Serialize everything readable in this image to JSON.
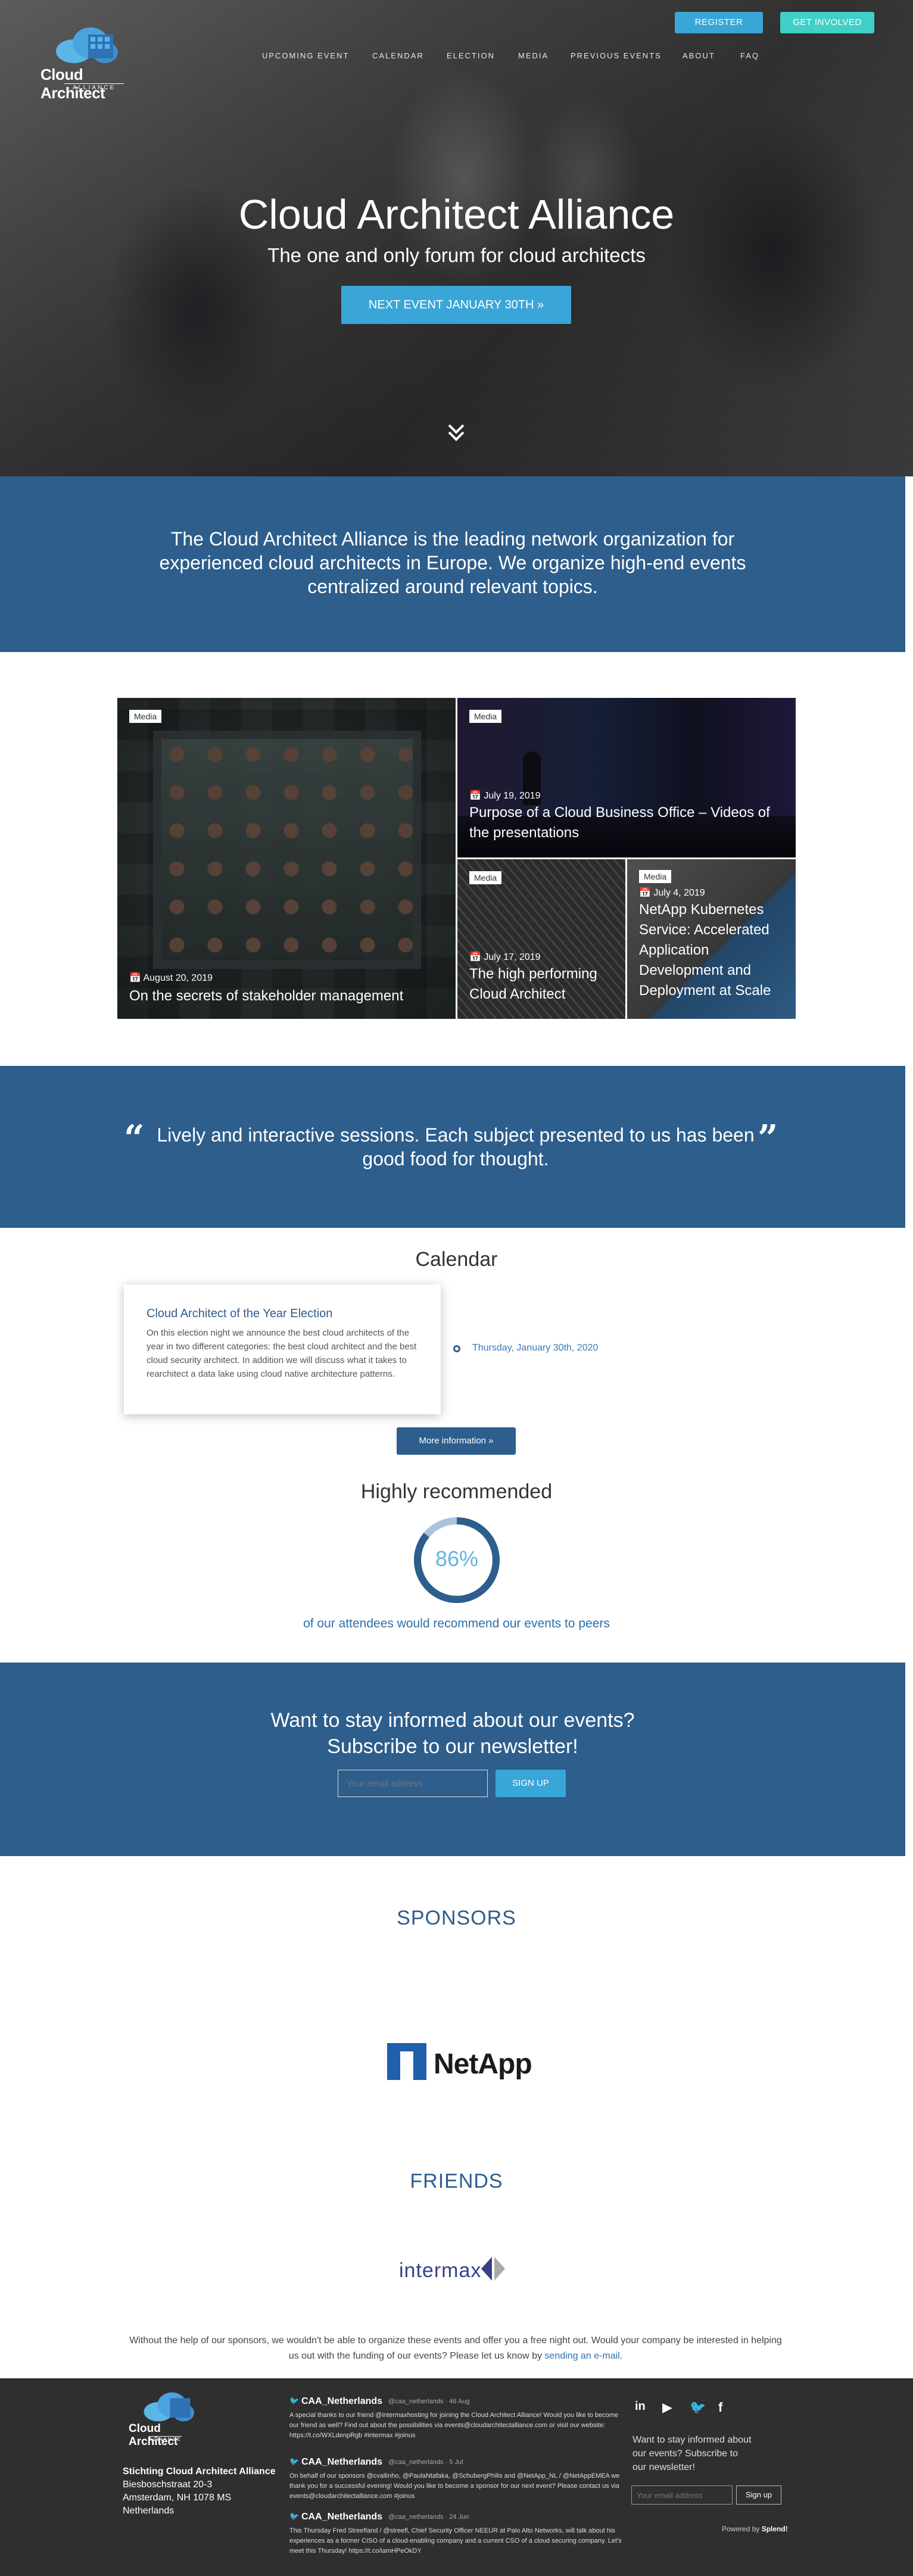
{
  "header": {
    "logo_title": "Cloud Architect",
    "logo_sub": "ALLIANCE",
    "register_label": "REGISTER",
    "involved_label": "GET INVOLVED",
    "nav": [
      "UPCOMING EVENT",
      "CALENDAR",
      "ELECTION",
      "MEDIA",
      "PREVIOUS EVENTS",
      "ABOUT",
      "FAQ"
    ]
  },
  "hero": {
    "title": "Cloud Architect Alliance",
    "subtitle": "The one and only forum for cloud architects",
    "cta": "NEXT EVENT JANUARY 30TH  »",
    "scroll_icon": "double-chevron-down"
  },
  "intro": {
    "text": "The Cloud Architect Alliance is the leading network organization for experienced cloud architects in Europe. We organize high-end events centralized around relevant topics."
  },
  "media": [
    {
      "badge": "Media",
      "date": "August 20, 2019",
      "title": "On the secrets of stakeholder management"
    },
    {
      "badge": "Media",
      "date": "July 19, 2019",
      "title": "Purpose of a Cloud Business Office – Videos of the presentations"
    },
    {
      "badge": "Media",
      "date": "July 17, 2019",
      "title": "The high performing Cloud Architect"
    },
    {
      "badge": "Media",
      "date": "July 4, 2019",
      "title": "NetApp Kubernetes Service: Accelerated Application Development and Deployment at Scale"
    }
  ],
  "quote": {
    "text": "Lively and interactive sessions. Each subject presented to us has been good food for thought."
  },
  "calendar": {
    "heading": "Calendar",
    "event_title": "Cloud Architect of the Year Election",
    "event_desc": "On this election night we announce the best cloud architects of the year in two different categories: the best cloud architect and the best cloud security architect. In addition we will discuss what it takes to rearchitect a data lake using cloud native architecture patterns.",
    "event_date": "Thursday, January 30th, 2020",
    "more_label": "More information  »"
  },
  "recommend": {
    "heading": "Highly recommended",
    "percent_label": "86%",
    "percent": 86,
    "subtitle": "of our attendees would recommend our events to peers"
  },
  "newsletter": {
    "line1": "Want to stay informed about our events?",
    "line2": "Subscribe to our newsletter!",
    "placeholder": "Your email address",
    "button": "SIGN UP"
  },
  "sponsors": {
    "heading": "SPONSORS",
    "logo": "NetApp"
  },
  "friends": {
    "heading": "FRIENDS",
    "logo": "intermax"
  },
  "help": {
    "text": "Without the help of our sponsors, we wouldn't be able to organize these events and offer you a free night out. Would your company be interested in helping us out with the funding of our events? Please let us know by ",
    "link": "sending an e-mail",
    "end": "."
  },
  "footer": {
    "org": "Stichting Cloud Architect Alliance",
    "street": "Biesboschstraat 20-3",
    "city": "Amsterdam, NH 1078 MS",
    "country": "Netherlands",
    "tweets": [
      {
        "user": "CAA_Netherlands",
        "handle": "@caa_netherlands · 46 Aug",
        "text": "A special thanks to our friend @intermaxhosting for joining the Cloud Architect Alliance! Would you like to become our friend as well? Find out about the possibilities via events@cloudarchitectalliance.com or visit our website: https://t.co/WXLdenpRgb #intermax #joinus"
      },
      {
        "user": "CAA_Netherlands",
        "handle": "@caa_netherlands · 5 Jul",
        "text": "On behalf of our sponsors @cvallinho, @PaulaNtafaka, @SchubergPhilis and @NetApp_NL / @NetAppEMEA we thank you for a successful evening! Would you like to become a sponsor for our next event? Please contact us via events@cloudarchitectalliance.com #joinus"
      },
      {
        "user": "CAA_Netherlands",
        "handle": "@caa_netherlands · 24 Jun",
        "text": "This Thursday Fred Streefland / @streefl, Chief Security Officer NEEUR at Palo Alto Networks, will talk about his experiences as a former CISO of a cloud-enabling company and a current CSO of a cloud securing company. Let's meet this Thursday! https://t.co/iamHPeOkDY"
      }
    ],
    "social": [
      "in",
      "You",
      "tw",
      "f"
    ],
    "news_text": "Want to stay informed about our events? Subscribe to our newsletter!",
    "placeholder": "Your email address",
    "signup": "Sign up",
    "powered_prefix": "Powered by ",
    "powered_brand": "Splend!"
  }
}
